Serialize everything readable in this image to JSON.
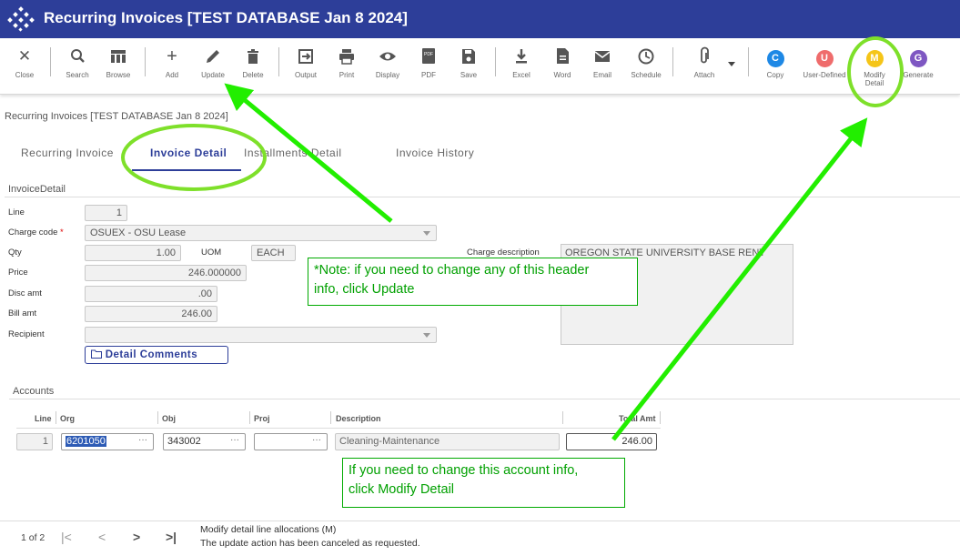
{
  "window": {
    "title": "Recurring Invoices [TEST DATABASE Jan 8 2024]"
  },
  "toolbar": {
    "close": "Close",
    "search": "Search",
    "browse": "Browse",
    "add": "Add",
    "update": "Update",
    "delete": "Delete",
    "output": "Output",
    "print": "Print",
    "display": "Display",
    "pdf": "PDF",
    "save": "Save",
    "excel": "Excel",
    "word": "Word",
    "email": "Email",
    "schedule": "Schedule",
    "attach": "Attach",
    "copy": "Copy",
    "user_defined": "User-Defined",
    "modify_detail_1": "Modify",
    "modify_detail_2": "Detail",
    "generate": "Generate",
    "copy_letter": "C",
    "user_defined_letter": "U",
    "modify_letter": "M",
    "generate_letter": "G"
  },
  "breadcrumb": "Recurring Invoices [TEST DATABASE Jan 8 2024]",
  "tabs": {
    "recurring_invoice": "Recurring Invoice",
    "invoice_detail": "Invoice Detail",
    "installments_detail": "Installments Detail",
    "invoice_history": "Invoice History"
  },
  "invoice_detail": {
    "section_title": "InvoiceDetail",
    "line_label": "Line",
    "line_value": "1",
    "charge_code_label": "Charge code",
    "charge_code_required": "*",
    "charge_code_value": "OSUEX - OSU Lease",
    "qty_label": "Qty",
    "qty_value": "1.00",
    "uom_label": "UOM",
    "uom_value": "EACH",
    "price_label": "Price",
    "price_value": "246.000000",
    "disc_label": "Disc amt",
    "disc_value": ".00",
    "bill_label": "Bill amt",
    "bill_value": "246.00",
    "recipient_label": "Recipient",
    "recipient_value": "",
    "charge_desc_label": "Charge description",
    "charge_desc_value": "OREGON STATE UNIVERSITY BASE RENT",
    "detail_comments": "Detail Comments"
  },
  "accounts": {
    "section_title": "Accounts",
    "columns": {
      "line": "Line",
      "org": "Org",
      "obj": "Obj",
      "proj": "Proj",
      "description": "Description",
      "total_amt": "Total Amt"
    },
    "row": {
      "line": "1",
      "org": "6201050",
      "obj": "343002",
      "proj": "",
      "description": "Cleaning-Maintenance",
      "total_amt": "246.00"
    }
  },
  "annotations": {
    "note_update_1": "*Note: if you need to change any of this header",
    "note_update_2": "info, click Update",
    "note_modify_1": "If you need to change this  account info,",
    "note_modify_2": "click Modify Detail",
    "arrow_color": "#22ee00",
    "highlight_color": "#7ee02a"
  },
  "status": {
    "page_indicator": "1 of 2",
    "message_1": "Modify detail line allocations (M)",
    "message_2": "The update action has been canceled as requested."
  },
  "colors": {
    "brand": "#2d3e99",
    "copy": "#1e88e5",
    "user_defined": "#ef6c6c",
    "modify": "#f5c518",
    "generate": "#7e57c2"
  }
}
